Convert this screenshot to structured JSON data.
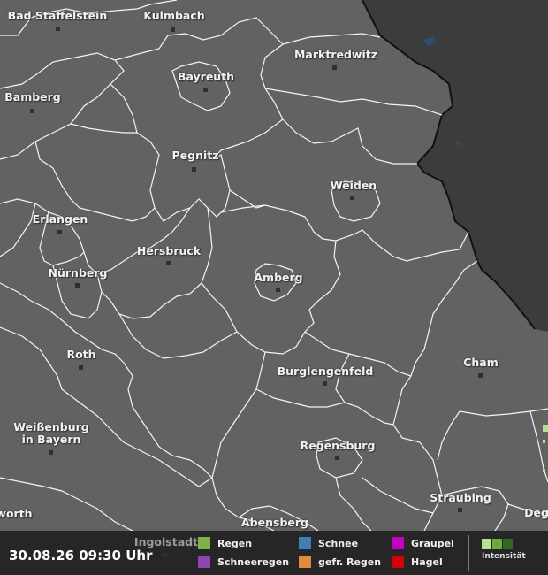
{
  "map": {
    "cities": [
      {
        "name": "Bad Staffelstein"
      },
      {
        "name": "Kulmbach"
      },
      {
        "name": "Marktredwitz"
      },
      {
        "name": "Bayreuth"
      },
      {
        "name": "Bamberg"
      },
      {
        "name": "Pegnitz"
      },
      {
        "name": "Weiden"
      },
      {
        "name": "Erlangen"
      },
      {
        "name": "Hersbruck"
      },
      {
        "name": "Nürnberg"
      },
      {
        "name": "Amberg"
      },
      {
        "name": "Roth"
      },
      {
        "name": "Burglengenfeld"
      },
      {
        "name": "Cham"
      },
      {
        "name": "Weißenburg in Bayern"
      },
      {
        "name": "Regensburg"
      },
      {
        "name": "Straubing"
      },
      {
        "name": "Abensberg"
      },
      {
        "name": "Ingolstadt"
      },
      {
        "name": "Deg"
      },
      {
        "name": "worth"
      }
    ]
  },
  "legend": {
    "timestamp": "30.08.26 09:30 Uhr",
    "items": [
      {
        "label": "Regen",
        "color": "#7cb342"
      },
      {
        "label": "Schneeregen",
        "color": "#8e44ad"
      },
      {
        "label": "Schnee",
        "color": "#3f7fb8"
      },
      {
        "label": "gefr. Regen",
        "color": "#e08a3a"
      },
      {
        "label": "Graupel",
        "color": "#c400c4"
      },
      {
        "label": "Hagel",
        "color": "#d40000"
      }
    ],
    "intensity_label": "Intensität",
    "intensity_colors": [
      "#b7e08a",
      "#6fa83e",
      "#2f6b1c"
    ]
  }
}
